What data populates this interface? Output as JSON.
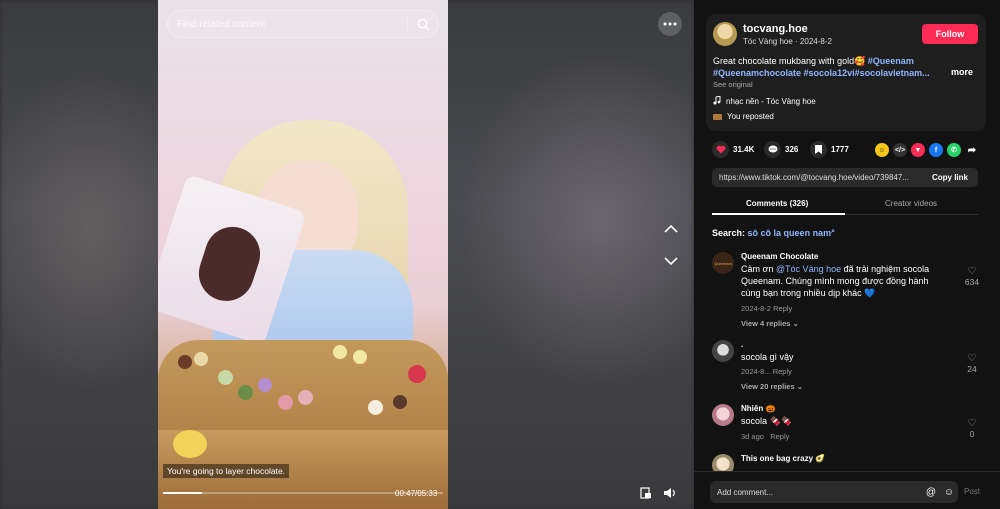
{
  "video": {
    "search_placeholder": "Find related content",
    "caption": "You're going to layer chocolate.",
    "current_time": "00:47",
    "duration": "05:33",
    "time_separator": "/",
    "progress": 0.14
  },
  "post": {
    "username": "tocvang.hoe",
    "display_name": "Tóc Vàng hoe",
    "date": "2024-8-2",
    "separator": " · ",
    "follow_label": "Follow",
    "description_text": "Great chocolate mukbang with gold🥰 ",
    "tags": [
      "#Queenam",
      "#Queenamchocolate",
      "#socola12vi",
      "#socolavietnam..."
    ],
    "more_label": "more",
    "see_original": "See original",
    "music": "nhạc nền - Tóc Vàng hoe",
    "repost": "You reposted"
  },
  "stats": {
    "likes": "31.4K",
    "comments": "326",
    "saves": "1777"
  },
  "link": {
    "url": "https://www.tiktok.com/@tocvang.hoe/video/739847...",
    "copy_label": "Copy link"
  },
  "tabs": {
    "comments": "Comments (326)",
    "creator_videos": "Creator videos"
  },
  "search_suggestion": {
    "label": "Search:",
    "query": "sô cô la queen nam"
  },
  "comments": [
    {
      "name": "Queenam Chocolate",
      "text_prefix": "Cảm ơn ",
      "mention": "@Tóc Vàng hoe",
      "text_suffix": " đã trải nghiệm socola Queenam. Chúng mình mong được đồng hành cùng bạn trong nhiều dịp khác 💙",
      "date": "2024-8-2",
      "reply": "Reply",
      "view_replies": "View 4 replies",
      "likes": "634"
    },
    {
      "name": ".",
      "text": "socola gì vậy",
      "date": "2024-8...",
      "reply": "Reply",
      "view_replies": "View 20 replies",
      "likes": "24"
    },
    {
      "name": "Nhiên 🎃",
      "text": "socola 🍫🍫",
      "date": "3d ago",
      "reply": "Reply",
      "likes": "0"
    },
    {
      "name": "This one bag crazy 🥑",
      "text": ""
    }
  ],
  "composer": {
    "placeholder": "Add comment...",
    "post_label": "Post"
  },
  "colors": {
    "accent": "#fe2c55",
    "hashtag": "#8fb7ff",
    "panel_bg": "#121212"
  }
}
